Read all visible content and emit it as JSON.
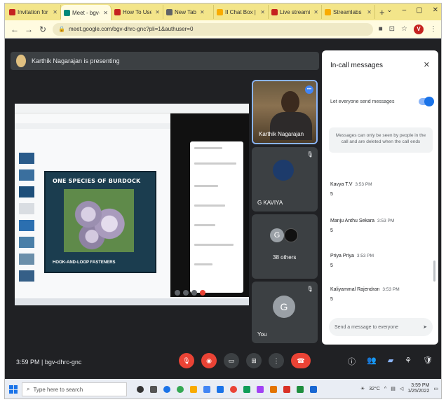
{
  "browser": {
    "tabs": [
      {
        "label": "Invitation for the",
        "color": "#c5221f"
      },
      {
        "label": "Meet - bgv-",
        "color": "#00897b",
        "active": true
      },
      {
        "label": "How To Use T",
        "color": "#c5221f"
      },
      {
        "label": "New Tab",
        "color": "#5f6368"
      },
      {
        "label": "II Chat Box | Tr",
        "color": "#f9ab00"
      },
      {
        "label": "Live streaming",
        "color": "#c5221f"
      },
      {
        "label": "Streamlabs Pre",
        "color": "#f9ab00"
      }
    ],
    "new_tab": "+",
    "url": "meet.google.com/bgv-dhrc-gnc?pli=1&authuser=0",
    "profile_initial": "V"
  },
  "meet": {
    "presenter_text": "Karthik Nagarajan is presenting",
    "shared_slide": {
      "title": "ONE SPECIES OF BURDOCK",
      "subtitle": "HOOK-AND-LOOP FASTENERS"
    },
    "tiles": [
      {
        "name": "Karthik Nagarajan"
      },
      {
        "name": "G KAVIYA"
      },
      {
        "name": "38 others"
      },
      {
        "name": "You",
        "initial": "G"
      }
    ],
    "others_avatar_initial": "G",
    "meeting_time": "3:59 PM",
    "meeting_code": "bgv-dhrc-gnc"
  },
  "chat": {
    "title": "In-call messages",
    "allow_label": "Let everyone send messages",
    "notice": "Messages can only be seen by people in the call and are deleted when the call ends",
    "messages": [
      {
        "sender": "Kavya T.V",
        "time": "3:53 PM",
        "text": "5"
      },
      {
        "sender": "Manju Anthu Sekara",
        "time": "3:53 PM",
        "text": "5"
      },
      {
        "sender": "Priya Priya",
        "time": "3:53 PM",
        "text": "5"
      },
      {
        "sender": "Kaliyammal Rajendran",
        "time": "3:53 PM",
        "text": "5"
      }
    ],
    "input_placeholder": "Send a message to everyone"
  },
  "taskbar": {
    "search_placeholder": "Type here to search",
    "weather": "32°C",
    "time": "3:59 PM",
    "date": "1/25/2022"
  },
  "colors": {
    "meet_bg": "#202124",
    "end_call": "#ea4335",
    "accent": "#1a73e8",
    "tab_strip": "#f3e58a"
  }
}
